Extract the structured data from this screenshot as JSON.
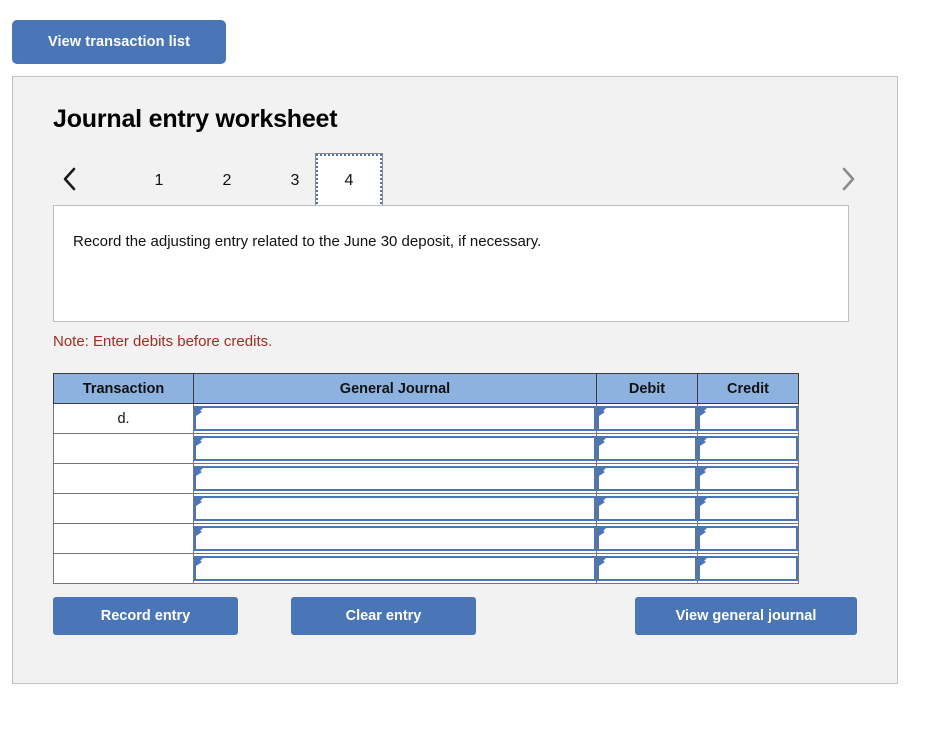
{
  "top": {
    "view_transaction_list_label": "View transaction list"
  },
  "panel": {
    "title": "Journal entry worksheet"
  },
  "tabs": {
    "prev_icon": "chevron-left-icon",
    "next_icon": "chevron-right-icon",
    "items": [
      {
        "label": "1",
        "selected": false
      },
      {
        "label": "2",
        "selected": false
      },
      {
        "label": "3",
        "selected": false
      },
      {
        "label": "4",
        "selected": true
      }
    ]
  },
  "instruction": {
    "text": "Record the adjusting entry related to the June 30 deposit, if necessary."
  },
  "note": {
    "text": "Note: Enter debits before credits."
  },
  "journal_table": {
    "headers": [
      "Transaction",
      "General Journal",
      "Debit",
      "Credit"
    ],
    "rows": [
      {
        "transaction": "d.",
        "general_journal": "",
        "debit": "",
        "credit": ""
      },
      {
        "transaction": "",
        "general_journal": "",
        "debit": "",
        "credit": ""
      },
      {
        "transaction": "",
        "general_journal": "",
        "debit": "",
        "credit": ""
      },
      {
        "transaction": "",
        "general_journal": "",
        "debit": "",
        "credit": ""
      },
      {
        "transaction": "",
        "general_journal": "",
        "debit": "",
        "credit": ""
      },
      {
        "transaction": "",
        "general_journal": "",
        "debit": "",
        "credit": ""
      }
    ]
  },
  "actions": {
    "record_entry_label": "Record entry",
    "clear_entry_label": "Clear entry",
    "view_general_journal_label": "View general journal"
  },
  "colors": {
    "button_blue": "#4a76b8",
    "header_blue": "#8db2e0",
    "panel_bg": "#f2f2f2",
    "note_red": "#a02c26",
    "cell_border_blue": "#4a76b8"
  }
}
